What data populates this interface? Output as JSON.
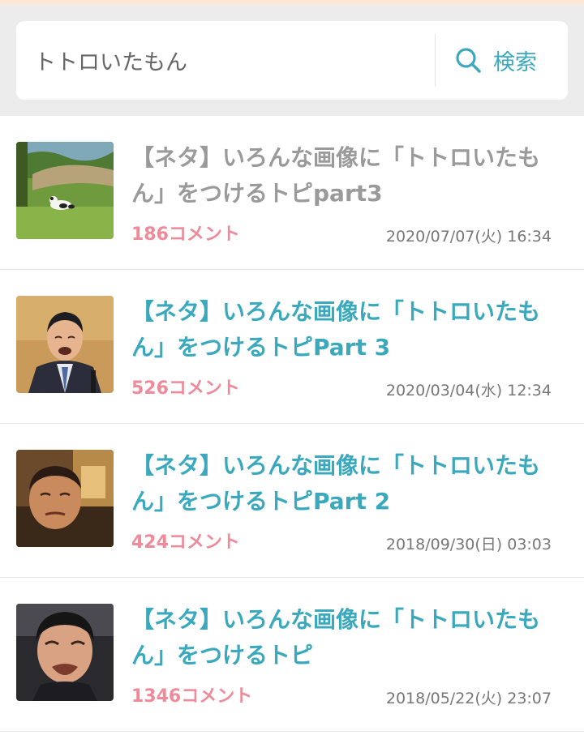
{
  "search": {
    "value": "トトロいたもん",
    "button_label": "検索"
  },
  "results": [
    {
      "title": "【ネタ】いろんな画像に「トトロいたもん」をつけるトピpart3",
      "comments": "186コメント",
      "date": "2020/07/07(火) 16:34",
      "thumbnail": "panda-photo",
      "visited": true
    },
    {
      "title": "【ネタ】いろんな画像に「トトロいたもん」をつけるトピPart 3",
      "comments": "526コメント",
      "date": "2020/03/04(水) 12:34",
      "thumbnail": "crying-man-photo",
      "visited": false
    },
    {
      "title": "【ネタ】いろんな画像に「トトロいたもん」をつけるトピPart 2",
      "comments": "424コメント",
      "date": "2018/09/30(日) 03:03",
      "thumbnail": "man-photo",
      "visited": false
    },
    {
      "title": "【ネタ】いろんな画像に「トトロいたもん」をつけるトピ",
      "comments": "1346コメント",
      "date": "2018/05/22(火) 23:07",
      "thumbnail": "crying-man-closeup-photo",
      "visited": false
    }
  ],
  "colors": {
    "accent": "#3aa8bd",
    "comment": "#ee8a99",
    "visited_title": "#9a9a9a"
  }
}
